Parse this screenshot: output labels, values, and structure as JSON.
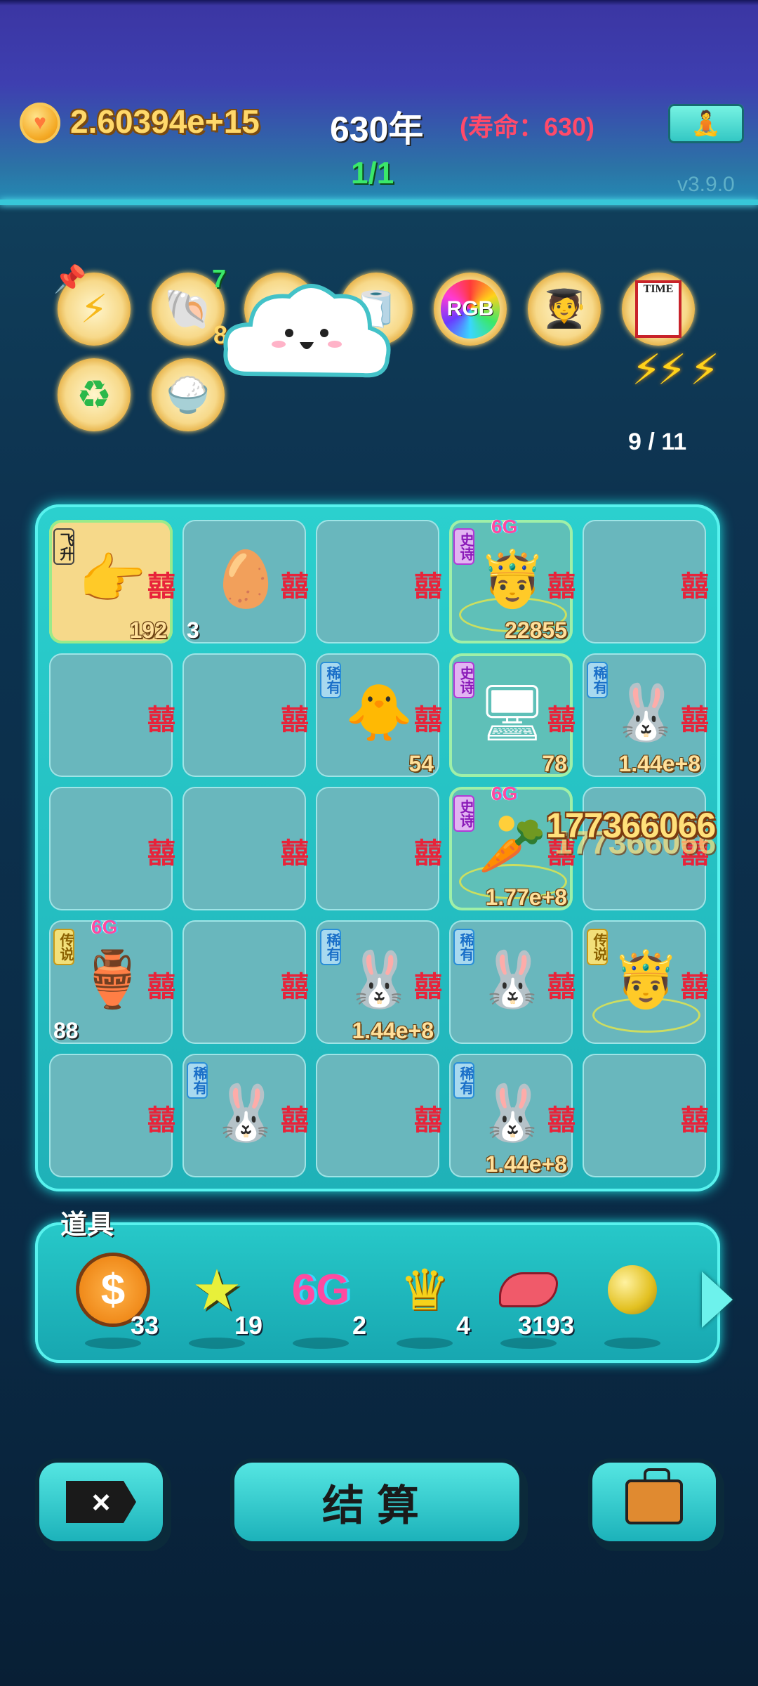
{
  "header": {
    "coin_value": "2.60394e+15",
    "year": "630年",
    "lifespan": "(寿命：630)",
    "progress": "1/1",
    "version": "v3.9.0"
  },
  "buffs": {
    "shell_badge_top": "7",
    "shell_badge_bottom": "8",
    "rgb_label": "RGB",
    "time_label": "TIME",
    "count": "9 / 11"
  },
  "board": {
    "cells": [
      {
        "tag": "飞升",
        "value": "192",
        "icon": "pointing-hand-icon"
      },
      {
        "value_left": "3",
        "icon": "egg-icon"
      },
      {},
      {
        "tag": "史诗",
        "gtag": "6G",
        "value": "22855",
        "icon": "king-avatar-icon"
      },
      {},
      {},
      {},
      {
        "tag": "稀有",
        "value": "54",
        "icon": "chick-icon"
      },
      {
        "tag": "史诗",
        "value": "78",
        "icon": "graphics-card-icon"
      },
      {
        "tag": "稀有",
        "value": "1.44e+8",
        "icon": "rabbit-icon"
      },
      {},
      {},
      {},
      {
        "tag": "史诗",
        "gtag": "6G",
        "value": "1.77e+8",
        "icon": "carrot-icon"
      },
      {},
      {
        "tag": "传说",
        "gtag": "6G",
        "value_left": "88",
        "icon": "vase-icon"
      },
      {},
      {
        "tag": "稀有",
        "value": "1.44e+8",
        "icon": "rabbit-icon"
      },
      {
        "tag": "稀有",
        "icon": "rabbit-icon"
      },
      {
        "tag": "传说",
        "icon": "king-avatar-icon"
      },
      {},
      {
        "tag": "稀有",
        "icon": "rabbit-icon"
      },
      {},
      {
        "tag": "稀有",
        "value": "1.44e+8",
        "icon": "rabbit-icon"
      },
      {}
    ],
    "float_number": "177366066"
  },
  "items": {
    "title": "道具",
    "list": [
      {
        "icon": "dollar-coin-icon",
        "glyph": "$",
        "count": "33"
      },
      {
        "icon": "star-icon",
        "glyph": "★",
        "count": "19"
      },
      {
        "icon": "6g-icon",
        "glyph": "6G",
        "count": "2"
      },
      {
        "icon": "crown-icon",
        "glyph": "♛",
        "count": "4"
      },
      {
        "icon": "liver-icon",
        "glyph": "",
        "count": "3193"
      },
      {
        "icon": "gold-ball-icon",
        "glyph": "",
        "count": ""
      }
    ]
  },
  "buttons": {
    "close": "×",
    "settle": "结算"
  },
  "colors": {
    "accent": "#2bd0ce",
    "coin": "#ffd86a",
    "progress": "#3ae86a",
    "lifespan": "#ff4a6a"
  }
}
